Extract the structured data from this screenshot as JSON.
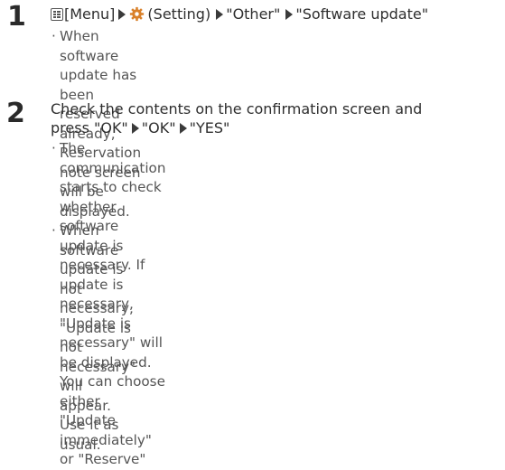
{
  "step1": {
    "number": "1",
    "menu_label": "[Menu]",
    "setting_label": "(Setting)",
    "other_label": "\"Other\"",
    "software_update_label": "\"Software update\"",
    "note1_line1": "When software update has been reserved already,",
    "note1_line2": "Reservation note screen will be displayed."
  },
  "step2": {
    "number": "2",
    "title_line1": "Check the contents on the confirmation screen and",
    "title_press": "press \"OK\"",
    "title_ok": "\"OK\"",
    "title_yes": "\"YES\"",
    "note1_line1": "The communication starts to check whether software",
    "note1_line2": "update is necessary. If update is necessary, \"Update is",
    "note1_line3": "necessary\" will be displayed. You can choose either",
    "note1_line4": "\"Update immediately\" or \"Reserve\"",
    "note2_line1": "When software update is not necessary, \"Update is not",
    "note2_line2": "necessary\" will appear. Use it as usual."
  },
  "bullet": "·",
  "colors": {
    "text": "#3a3a3a",
    "note_text": "#555555",
    "gear": "#d9812b"
  },
  "icons": {
    "menu": "menu-key-icon",
    "setting": "gear-icon",
    "arrow": "right-triangle-icon"
  }
}
